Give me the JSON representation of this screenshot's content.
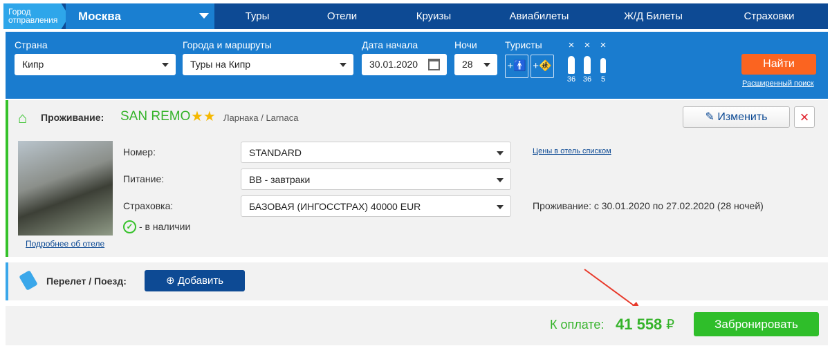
{
  "header": {
    "city_label": "Город отправления",
    "city": "Москва",
    "nav": [
      "Туры",
      "Отели",
      "Круизы",
      "Авиабилеты",
      "Ж/Д Билеты",
      "Страховки"
    ]
  },
  "search": {
    "country_label": "Страна",
    "country": "Кипр",
    "routes_label": "Города и маршруты",
    "routes": "Туры на Кипр",
    "date_label": "Дата начала",
    "date": "30.01.2020",
    "nights_label": "Ночи",
    "nights": "28",
    "tourists_label": "Туристы",
    "add_sign": "+",
    "remove_sign": "×",
    "tourists": [
      "36",
      "36",
      "5"
    ],
    "find": "Найти",
    "advanced": "Расширенный поиск"
  },
  "hotel": {
    "label": "Проживание:",
    "name": "SAN REMO",
    "stars": "★★",
    "location": "Ларнака / Larnaca",
    "edit": "Изменить",
    "room_label": "Номер:",
    "room": "STANDARD",
    "meal_label": "Питание:",
    "meal": "BB - завтраки",
    "insurance_label": "Страховка:",
    "insurance": "БАЗОВАЯ (ИНГОССТРАХ) 40000 EUR",
    "availability": "- в наличии",
    "more": "Подробнее об отеле",
    "prices_link": "Цены в отель списком",
    "stay": "Проживание: с 30.01.2020 по 27.02.2020 (28 ночей)"
  },
  "flight": {
    "label": "Перелет / Поезд:",
    "add": "Добавить"
  },
  "payment": {
    "label": "К оплате:",
    "amount": "41 558",
    "currency": "₽",
    "book": "Забронировать"
  }
}
